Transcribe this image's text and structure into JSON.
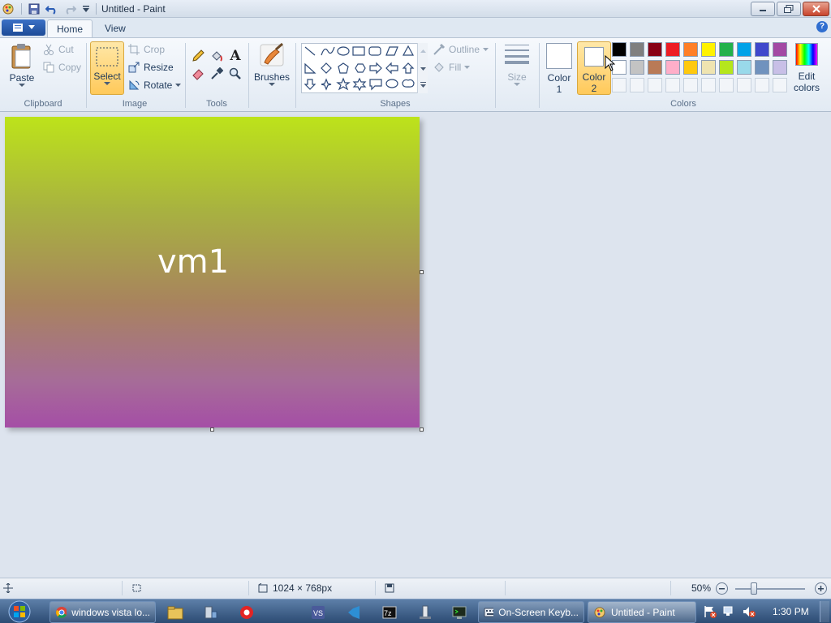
{
  "window": {
    "title": "Untitled - Paint"
  },
  "tabs": [
    {
      "label": "Home"
    },
    {
      "label": "View"
    }
  ],
  "clipboard": {
    "paste": "Paste",
    "cut": "Cut",
    "copy": "Copy",
    "group": "Clipboard"
  },
  "image": {
    "select": "Select",
    "crop": "Crop",
    "resize": "Resize",
    "rotate": "Rotate",
    "group": "Image"
  },
  "tools": {
    "group": "Tools",
    "items": [
      "pencil-icon",
      "fill-bucket-icon",
      "text-icon",
      "eraser-icon",
      "color-picker-icon",
      "magnifier-icon"
    ]
  },
  "brushes": {
    "label": "Brushes"
  },
  "shapes": {
    "group": "Shapes",
    "outline": "Outline",
    "fill": "Fill"
  },
  "size": {
    "label": "Size"
  },
  "colors": {
    "group": "Colors",
    "color1": {
      "label1": "Color",
      "label2": "1",
      "value": "#ffffff"
    },
    "color2": {
      "label1": "Color",
      "label2": "2",
      "value": "#ffffff"
    },
    "edit": {
      "label1": "Edit",
      "label2": "colors"
    },
    "row1": [
      "#000000",
      "#7f7f7f",
      "#880015",
      "#ed1c24",
      "#ff7f27",
      "#fff200",
      "#22b14c",
      "#00a2e8",
      "#3f48cc",
      "#a349a4"
    ],
    "row2": [
      "#ffffff",
      "#c3c3c3",
      "#b97a57",
      "#ffaec9",
      "#ffc90e",
      "#efe4b0",
      "#b5e61d",
      "#99d9ea",
      "#7092be",
      "#c8bfe7"
    ]
  },
  "canvas": {
    "text": "vm1",
    "gradient_top": "#bde31a",
    "gradient_bottom": "#a54ea6"
  },
  "status": {
    "dimensions": "1024 × 768px",
    "zoom": "50%"
  },
  "taskbar": {
    "buttons": [
      {
        "label": "windows vista lo..."
      },
      {
        "label": "On-Screen Keyb..."
      },
      {
        "label": "Untitled - Paint"
      }
    ],
    "time": "1:30 PM"
  }
}
